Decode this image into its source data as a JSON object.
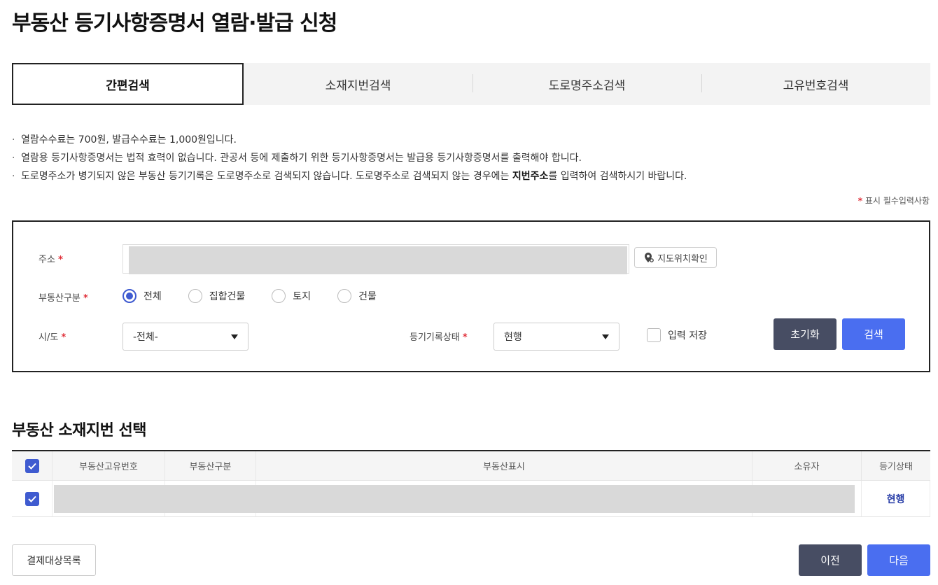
{
  "page": {
    "title": "부동산 등기사항증명서 열람·발급 신청"
  },
  "tabs": [
    {
      "label": "간편검색",
      "active": true
    },
    {
      "label": "소재지번검색",
      "active": false
    },
    {
      "label": "도로명주소검색",
      "active": false
    },
    {
      "label": "고유번호검색",
      "active": false
    }
  ],
  "notices": {
    "line1": "열람수수료는  700원, 발급수수료는  1,000원입니다.",
    "line2": "열람용 등기사항증명서는 법적 효력이 없습니다. 관공서 등에 제출하기 위한 등기사항증명서는 발급용 등기사항증명서를 출력해야 합니다.",
    "line3_a": "도로명주소가 병기되지 않은 부동산 등기기록은 도로명주소로 검색되지 않습니다. 도로명주소로 검색되지 않는 경우에는 ",
    "line3_bold": "지번주소",
    "line3_b": "를 입력하여 검색하시기 바랍니다.",
    "bullet": "·"
  },
  "required_note": {
    "star": "*",
    "text": "표시 필수입력사항"
  },
  "search": {
    "address_label": "주소",
    "address_value": "",
    "map_button": "지도위치확인",
    "type_label": "부동산구분",
    "type_options": [
      "전체",
      "집합건물",
      "토지",
      "건물"
    ],
    "type_selected": "전체",
    "region_label": "시/도",
    "region_value": "-전체-",
    "status_label": "등기기록상태",
    "status_value": "현행",
    "save_label": "입력 저장",
    "save_checked": false,
    "reset_button": "초기화",
    "search_button": "검색",
    "required_star": "*"
  },
  "results": {
    "title": "부동산 소재지번 선택",
    "headers": [
      "부동산고유번호",
      "부동산구분",
      "부동산표시",
      "소유자",
      "등기상태"
    ],
    "rows": [
      {
        "checked": true,
        "unique_no": "",
        "type": "",
        "display": "",
        "owner": "",
        "status": "현행"
      }
    ]
  },
  "footer": {
    "payment_list_button": "결제대상목록",
    "prev_button": "이전",
    "next_button": "다음"
  },
  "colors": {
    "accent_blue": "#4a6ef0",
    "dark_button": "#474d63",
    "radio_blue": "#3f5bd0",
    "required_red": "#e0303a",
    "status_link": "#2a3fa8"
  }
}
